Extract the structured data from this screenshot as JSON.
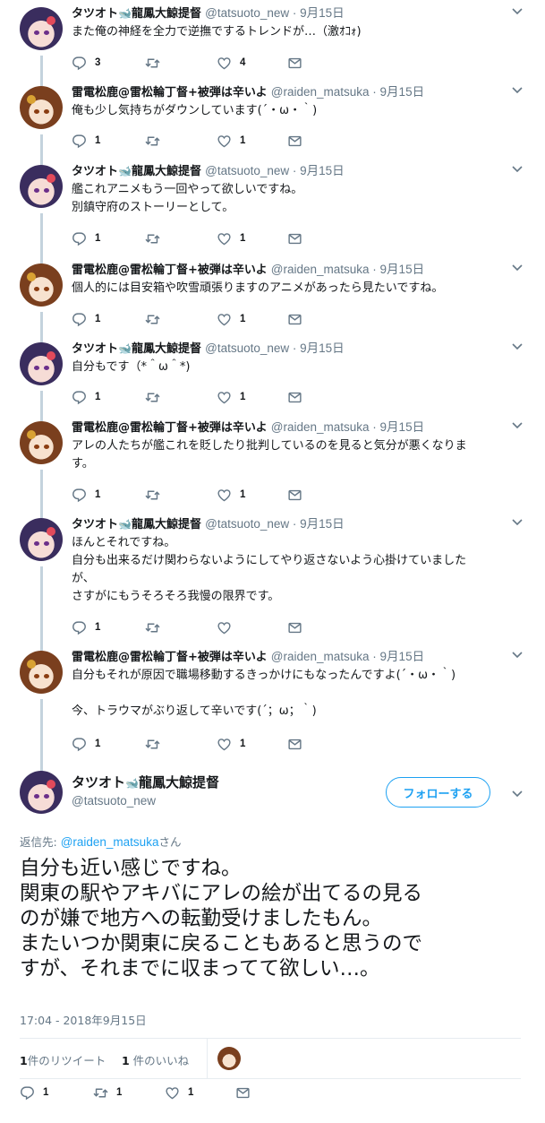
{
  "tweets": [
    {
      "user": "tatsu",
      "name": "タツオト",
      "name_suffix": "龍鳳大鯨提督",
      "handle": "@tatsuoto_new",
      "date": "9月15日",
      "lines": [
        "また俺の神経を全力で逆撫でするトレンドが…（激ｵｺｫ)"
      ],
      "replies": "3",
      "retweets": "",
      "likes": "4"
    },
    {
      "user": "raiden",
      "name": "雷電松鹿@雷松輪丁督+被弾は辛いよ",
      "name_suffix": "",
      "handle": "@raiden_matsuka",
      "date": "9月15日",
      "lines": [
        "俺も少し気持ちがダウンしています(´・ω・｀)"
      ],
      "replies": "1",
      "retweets": "",
      "likes": "1"
    },
    {
      "user": "tatsu",
      "name": "タツオト",
      "name_suffix": "龍鳳大鯨提督",
      "handle": "@tatsuoto_new",
      "date": "9月15日",
      "lines": [
        "艦これアニメもう一回やって欲しいですね。",
        "別鎮守府のストーリーとして。"
      ],
      "replies": "1",
      "retweets": "",
      "likes": "1"
    },
    {
      "user": "raiden",
      "name": "雷電松鹿@雷松輪丁督+被弾は辛いよ",
      "name_suffix": "",
      "handle": "@raiden_matsuka",
      "date": "9月15日",
      "lines": [
        "個人的には目安箱や吹雪頑張りますのアニメがあったら見たいですね。"
      ],
      "replies": "1",
      "retweets": "",
      "likes": "1"
    },
    {
      "user": "tatsu",
      "name": "タツオト",
      "name_suffix": "龍鳳大鯨提督",
      "handle": "@tatsuoto_new",
      "date": "9月15日",
      "lines": [
        "自分もです（*＾ω＾*)"
      ],
      "replies": "1",
      "retweets": "",
      "likes": "1"
    },
    {
      "user": "raiden",
      "name": "雷電松鹿@雷松輪丁督+被弾は辛いよ",
      "name_suffix": "",
      "handle": "@raiden_matsuka",
      "date": "9月15日",
      "lines": [
        "アレの人たちが艦これを貶したり批判しているのを見ると気分が悪くなりま",
        "す。"
      ],
      "replies": "1",
      "retweets": "",
      "likes": "1"
    },
    {
      "user": "tatsu",
      "name": "タツオト",
      "name_suffix": "龍鳳大鯨提督",
      "handle": "@tatsuoto_new",
      "date": "9月15日",
      "lines": [
        "ほんとそれですね。",
        "自分も出来るだけ関わらないようにしてやり返さないよう心掛けていました",
        "が、",
        "さすがにもうそろそろ我慢の限界です。"
      ],
      "replies": "1",
      "retweets": "",
      "likes": ""
    },
    {
      "user": "raiden",
      "name": "雷電松鹿@雷松輪丁督+被弾は辛いよ",
      "name_suffix": "",
      "handle": "@raiden_matsuka",
      "date": "9月15日",
      "lines": [
        "自分もそれが原因で職場移動するきっかけにもなったんですよ(´・ω・｀)",
        "",
        "今、トラウマがぶり返して辛いです(´；ω；｀)"
      ],
      "replies": "1",
      "retweets": "",
      "likes": "1"
    }
  ],
  "main_tweet": {
    "name": "タツオト",
    "name_suffix": "龍鳳大鯨提督",
    "handle": "@tatsuoto_new",
    "follow_label": "フォローする",
    "replying_prefix": "返信先: ",
    "replying_mention": "@raiden_matsuka",
    "replying_suffix": "さん",
    "lines": [
      "自分も近い感じですね。",
      "関東の駅やアキバにアレの絵が出てるの見る",
      "のが嫌で地方への転勤受けましたもん。",
      "またいつか関東に戻ることもあると思うので",
      "すが、それまでに収まってて欲しい…。"
    ],
    "timestamp": "17:04 - 2018年9月15日",
    "retweet_count": "1",
    "retweet_label": "件のリツイート",
    "like_count": "1",
    "like_label": " 件のいいね",
    "replies": "1",
    "retweets": "1",
    "likes": "1"
  },
  "colors": {
    "accent": "#1da1f2",
    "muted": "#657786",
    "thread_line": "#c4d3dd"
  }
}
